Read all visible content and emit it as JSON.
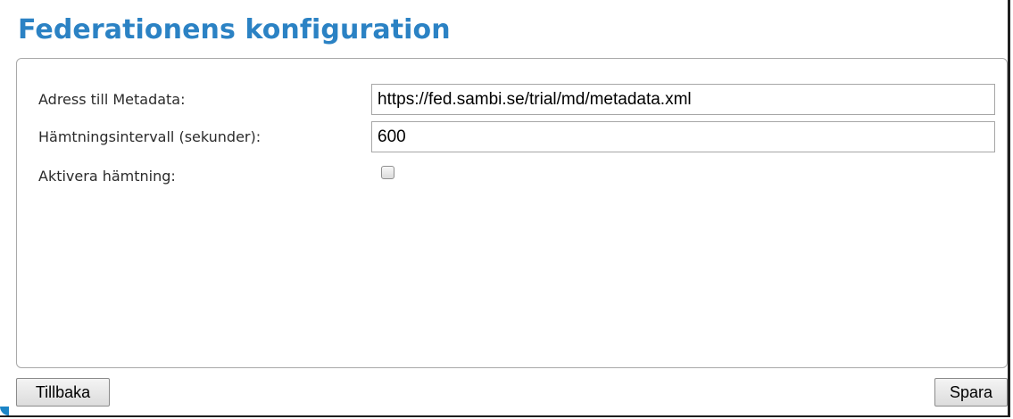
{
  "page": {
    "title": "Federationens konfiguration"
  },
  "form": {
    "metadata_address": {
      "label": "Adress till Metadata:",
      "value": "https://fed.sambi.se/trial/md/metadata.xml"
    },
    "fetch_interval": {
      "label": "Hämtningsintervall (sekunder):",
      "value": "600"
    },
    "activate_fetch": {
      "label": "Aktivera hämtning:",
      "checked": false
    }
  },
  "actions": {
    "back_label": "Tillbaka",
    "save_label": "Spara"
  },
  "colors": {
    "title": "#2b82c4",
    "border": "#a9a9a9",
    "accent": "#1b84c6"
  }
}
